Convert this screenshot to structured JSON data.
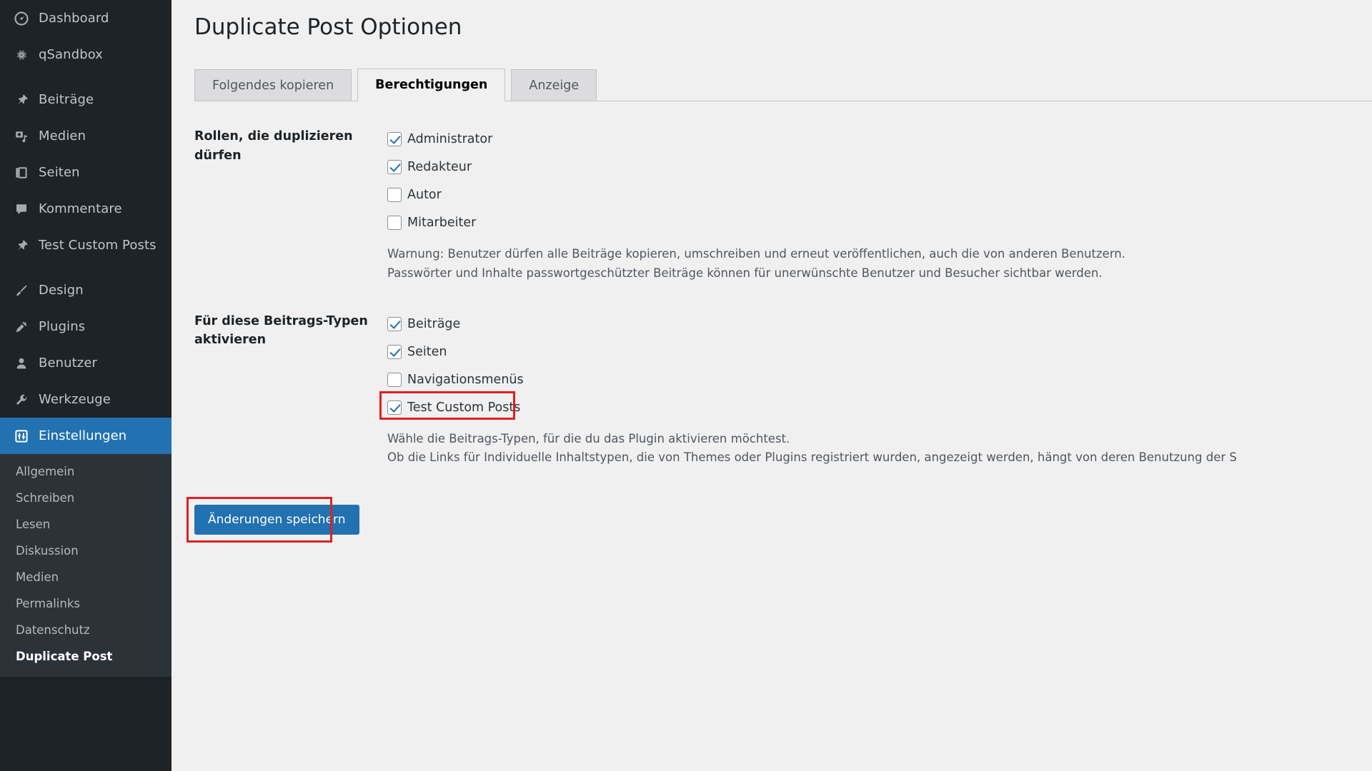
{
  "sidebar": {
    "primary_items": [
      {
        "label": "Dashboard",
        "icon": "dashboard-icon",
        "active": false
      },
      {
        "label": "qSandbox",
        "icon": "gear-icon",
        "active": false
      },
      {
        "label": "Beiträge",
        "icon": "pin-icon",
        "active": false
      },
      {
        "label": "Medien",
        "icon": "media-icon",
        "active": false
      },
      {
        "label": "Seiten",
        "icon": "pages-icon",
        "active": false
      },
      {
        "label": "Kommentare",
        "icon": "comment-icon",
        "active": false
      },
      {
        "label": "Test Custom Posts",
        "icon": "pin-icon",
        "active": false
      },
      {
        "label": "Design",
        "icon": "brush-icon",
        "active": false
      },
      {
        "label": "Plugins",
        "icon": "plug-icon",
        "active": false
      },
      {
        "label": "Benutzer",
        "icon": "user-icon",
        "active": false
      },
      {
        "label": "Werkzeuge",
        "icon": "wrench-icon",
        "active": false
      },
      {
        "label": "Einstellungen",
        "icon": "settings-icon",
        "active": true
      }
    ],
    "submenu_items": [
      {
        "label": "Allgemein",
        "current": false
      },
      {
        "label": "Schreiben",
        "current": false
      },
      {
        "label": "Lesen",
        "current": false
      },
      {
        "label": "Diskussion",
        "current": false
      },
      {
        "label": "Medien",
        "current": false
      },
      {
        "label": "Permalinks",
        "current": false
      },
      {
        "label": "Datenschutz",
        "current": false
      },
      {
        "label": "Duplicate Post",
        "current": true
      }
    ]
  },
  "page": {
    "title": "Duplicate Post Optionen"
  },
  "tabs": [
    {
      "label": "Folgendes kopieren",
      "active": false
    },
    {
      "label": "Berechtigungen",
      "active": true
    },
    {
      "label": "Anzeige",
      "active": false
    }
  ],
  "roles_section": {
    "label": "Rollen, die duplizieren dürfen",
    "options": [
      {
        "label": "Administrator",
        "checked": true
      },
      {
        "label": "Redakteur",
        "checked": true
      },
      {
        "label": "Autor",
        "checked": false
      },
      {
        "label": "Mitarbeiter",
        "checked": false
      }
    ],
    "description_line1": "Warnung: Benutzer dürfen alle Beiträge kopieren, umschreiben und erneut veröffentlichen, auch die von anderen Benutzern.",
    "description_line2": "Passwörter und Inhalte passwortgeschützter Beiträge können für unerwünschte Benutzer und Besucher sichtbar werden."
  },
  "post_types_section": {
    "label": "Für diese Beitrags-Typen aktivieren",
    "options": [
      {
        "label": "Beiträge",
        "checked": true,
        "highlighted": false
      },
      {
        "label": "Seiten",
        "checked": true,
        "highlighted": false
      },
      {
        "label": "Navigationsmenüs",
        "checked": false,
        "highlighted": false
      },
      {
        "label": "Test Custom Posts",
        "checked": true,
        "highlighted": true
      }
    ],
    "description_line1": "Wähle die Beitrags-Typen, für die du das Plugin aktivieren möchtest.",
    "description_line2": "Ob die Links für Individuelle Inhaltstypen, die von Themes oder Plugins registriert wurden, angezeigt werden, hängt von deren Benutzung der S"
  },
  "actions": {
    "save_label": "Änderungen speichern",
    "save_highlighted": true
  },
  "colors": {
    "accent": "#2271b1",
    "sidebar_bg": "#1d2327",
    "submenu_bg": "#2c3338",
    "page_bg": "#f0f0f1",
    "annotation": "#e02020"
  }
}
